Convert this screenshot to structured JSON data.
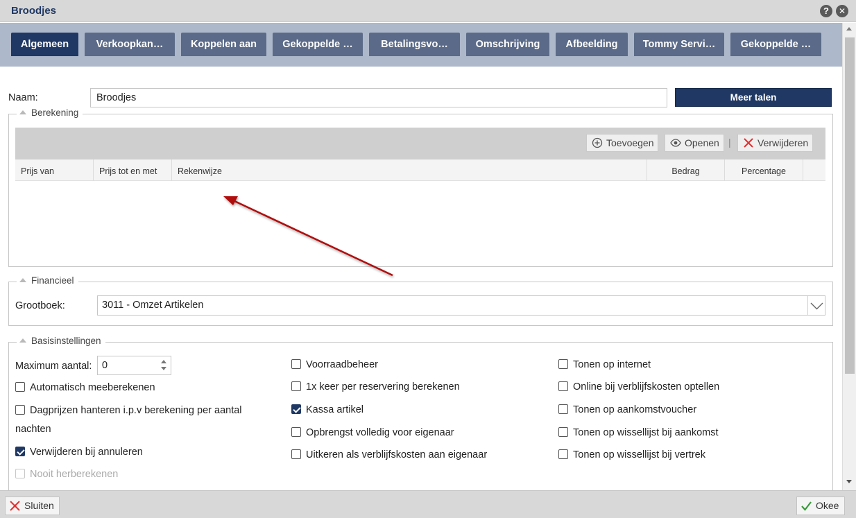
{
  "window": {
    "title": "Broodjes",
    "help_label": "?",
    "close_label": "✕"
  },
  "tabs": [
    {
      "label": "Algemeen",
      "active": true
    },
    {
      "label": "Verkoopkan…",
      "active": false
    },
    {
      "label": "Koppelen aan",
      "active": false
    },
    {
      "label": "Gekoppelde …",
      "active": false
    },
    {
      "label": "Betalingsvo…",
      "active": false
    },
    {
      "label": "Omschrijving",
      "active": false
    },
    {
      "label": "Afbeelding",
      "active": false
    },
    {
      "label": "Tommy Servi…",
      "active": false
    },
    {
      "label": "Gekoppelde …",
      "active": false
    }
  ],
  "naam": {
    "label": "Naam:",
    "value": "Broodjes",
    "more_languages_button": "Meer talen"
  },
  "berekening": {
    "legend": "Berekening",
    "toolbar": {
      "add_label": "Toevoegen",
      "open_label": "Openen",
      "delete_label": "Verwijderen",
      "separator": "|"
    },
    "columns": [
      "Prijs van",
      "Prijs tot en met",
      "Rekenwijze",
      "Bedrag",
      "Percentage"
    ]
  },
  "financieel": {
    "legend": "Financieel",
    "grootboek_label": "Grootboek:",
    "grootboek_value": "3011 - Omzet Artikelen"
  },
  "basisinstellingen": {
    "legend": "Basisinstellingen",
    "max_label": "Maximum aantal:",
    "max_value": "0",
    "col1": [
      {
        "label": "Automatisch meeberekenen",
        "checked": false,
        "disabled": false
      },
      {
        "label": "Dagprijzen hanteren i.p.v berekening per aantal",
        "label_line2": "nachten",
        "checked": false,
        "disabled": false
      },
      {
        "label": "Verwijderen bij annuleren",
        "checked": true,
        "disabled": false
      },
      {
        "label": "Nooit herberekenen",
        "checked": false,
        "disabled": true
      }
    ],
    "col2": [
      {
        "label": "Voorraadbeheer",
        "checked": false
      },
      {
        "label": "1x keer per reservering berekenen",
        "checked": false
      },
      {
        "label": "Kassa artikel",
        "checked": true
      },
      {
        "label": "Opbrengst volledig voor eigenaar",
        "checked": false
      },
      {
        "label": "Uitkeren als verblijfskosten aan eigenaar",
        "checked": false
      }
    ],
    "col3": [
      {
        "label": "Tonen op internet",
        "checked": false
      },
      {
        "label": "Online bij verblijfskosten optellen",
        "checked": false
      },
      {
        "label": "Tonen op aankomstvoucher",
        "checked": false
      },
      {
        "label": "Tonen op wissellijst bij aankomst",
        "checked": false
      },
      {
        "label": "Tonen op wissellijst bij vertrek",
        "checked": false
      }
    ]
  },
  "footer": {
    "close_label": "Sluiten",
    "ok_label": "Okee"
  },
  "colors": {
    "navy": "#1f3864",
    "tab_inactive": "#5a6a88",
    "tabstrip_bg": "#aeb8cb",
    "annotation_arrow": "#b01010",
    "delete_red": "#e03030",
    "ok_green": "#3a9a3a"
  },
  "icons": {
    "help": "help-icon",
    "close": "close-icon",
    "add": "plus-circle-icon",
    "open": "eye-icon",
    "delete": "x-icon",
    "dropdown": "chevron-down-icon",
    "footer_close": "x-icon",
    "footer_ok": "checkmark-icon"
  }
}
